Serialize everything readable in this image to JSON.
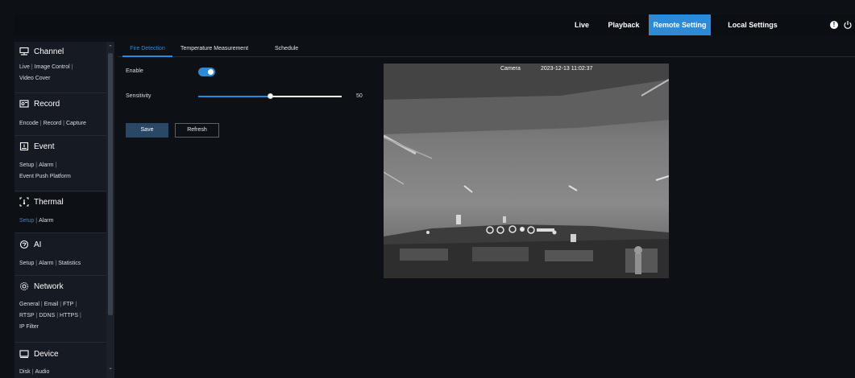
{
  "topnav": {
    "live": "Live",
    "playback": "Playback",
    "remote_setting": "Remote Setting",
    "local_settings": "Local Settings",
    "info_icon": "!",
    "power_icon": "power-icon"
  },
  "sidebar": {
    "sections": [
      {
        "title": "Channel",
        "icon": "channel-icon",
        "links": [
          "Live",
          "Image Control",
          "Video Cover"
        ]
      },
      {
        "title": "Record",
        "icon": "record-icon",
        "links": [
          "Encode",
          "Record",
          "Capture"
        ]
      },
      {
        "title": "Event",
        "icon": "event-icon",
        "links": [
          "Setup",
          "Alarm",
          "Event Push Platform"
        ]
      },
      {
        "title": "Thermal",
        "icon": "thermal-icon",
        "links": [
          "Setup",
          "Alarm"
        ],
        "active_link": "Setup"
      },
      {
        "title": "AI",
        "icon": "ai-icon",
        "links": [
          "Setup",
          "Alarm",
          "Statistics"
        ]
      },
      {
        "title": "Network",
        "icon": "network-icon",
        "links": [
          "General",
          "Email",
          "FTP",
          "RTSP",
          "DDNS",
          "HTTPS",
          "IP Filter"
        ]
      },
      {
        "title": "Device",
        "icon": "device-icon",
        "links": [
          "Disk",
          "Audio"
        ]
      }
    ]
  },
  "tabs": {
    "fire": "Fire Detection",
    "temp": "Temperature Measurement",
    "schedule": "Schedule",
    "active": "Fire Detection"
  },
  "form": {
    "enable_label": "Enable",
    "enable_value": true,
    "sensitivity_label": "Sensitivity",
    "sensitivity_value": "50",
    "sensitivity_fraction": 0.5,
    "save": "Save",
    "refresh": "Refresh"
  },
  "preview": {
    "camera_label": "Camera",
    "timestamp": "2023-12-13 11:02:37"
  },
  "colors": {
    "accent": "#2d8ad6",
    "background": "#0d1015",
    "sidebar": "#161a22"
  }
}
